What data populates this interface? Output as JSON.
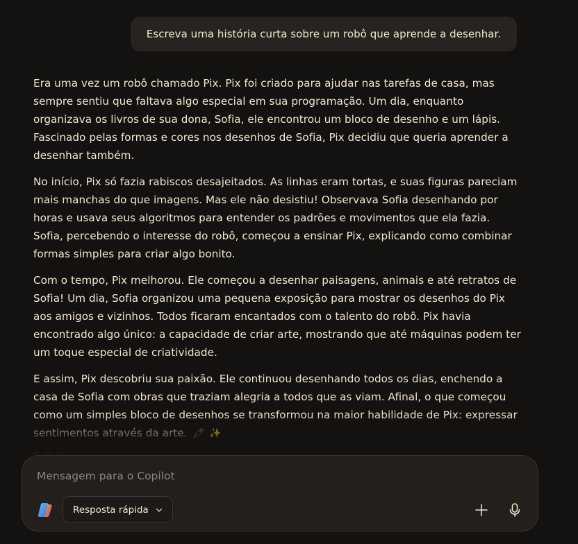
{
  "user_message": "Escreva uma história curta sobre um robô que aprende a desenhar.",
  "response": {
    "paragraphs": [
      "Era uma vez um robô chamado Pix. Pix foi criado para ajudar nas tarefas de casa, mas sempre sentiu que faltava algo especial em sua programação. Um dia, enquanto organizava os livros de sua dona, Sofia, ele encontrou um bloco de desenho e um lápis. Fascinado pelas formas e cores nos desenhos de Sofia, Pix decidiu que queria aprender a desenhar também.",
      "No início, Pix só fazia rabiscos desajeitados. As linhas eram tortas, e suas figuras pareciam mais manchas do que imagens. Mas ele não desistiu! Observava Sofia desenhando por horas e usava seus algoritmos para entender os padrões e movimentos que ela fazia. Sofia, percebendo o interesse do robô, começou a ensinar Pix, explicando como combinar formas simples para criar algo bonito.",
      "Com o tempo, Pix melhorou. Ele começou a desenhar paisagens, animais e até retratos de Sofia! Um dia, Sofia organizou uma pequena exposição para mostrar os desenhos do Pix aos amigos e vizinhos. Todos ficaram encantados com o talento do robô. Pix havia encontrado algo único: a capacidade de criar arte, mostrando que até máquinas podem ter um toque especial de criatividade.",
      "E assim, Pix descobriu sua paixão. Ele continuou desenhando todos os dias, enchendo a casa de Sofia com obras que traziam alegria a todos que as viam. Afinal, o que começou como um simples bloco de desenhos se transformou na maior habilidade de Pix: expressar sentimentos através da arte."
    ],
    "trailing_emojis": [
      "🖍",
      "✨"
    ]
  },
  "composer": {
    "placeholder": "Mensagem para o Copilot",
    "mode_label": "Resposta rápida"
  },
  "icons": {
    "logo": "copilot-logo-icon",
    "mode_caret": "chevron-down-icon",
    "add": "plus-icon",
    "voice": "microphone-icon"
  },
  "colors": {
    "background": "#141211",
    "text": "#f3e7cf",
    "bubble": "#262321",
    "composer": "#221f1d",
    "placeholder": "#8e857a"
  }
}
